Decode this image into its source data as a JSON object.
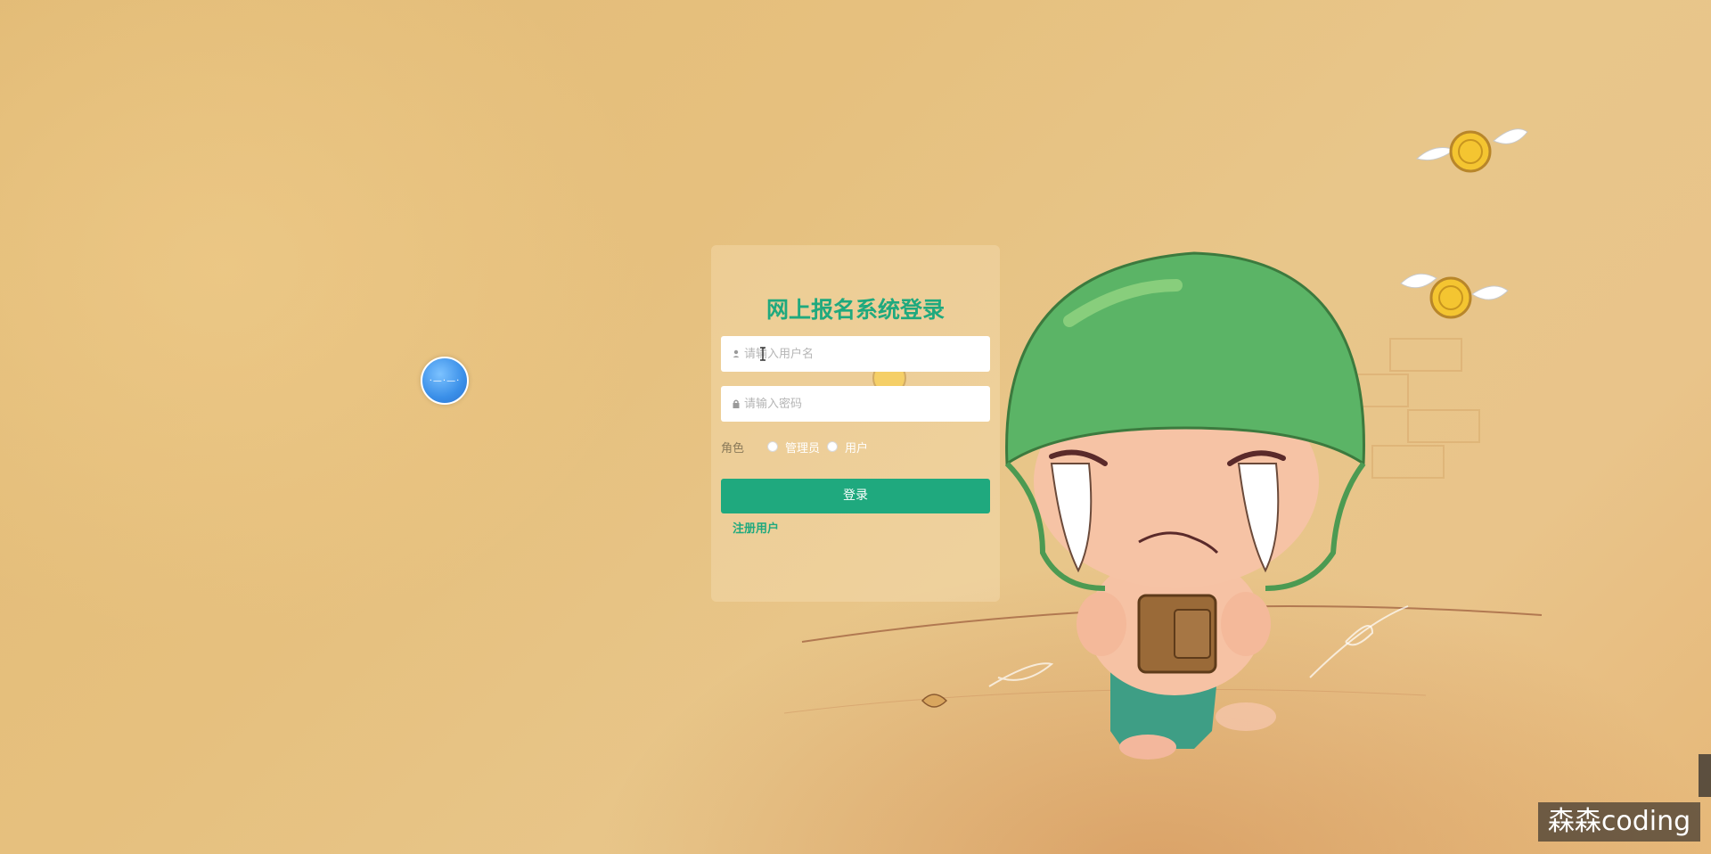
{
  "login": {
    "title": "网上报名系统登录",
    "username_placeholder": "请输入用户名",
    "password_placeholder": "请输入密码",
    "role_label": "角色",
    "roles": [
      "管理员",
      "用户"
    ],
    "login_button": "登录",
    "register_link": "注册用户"
  },
  "watermark": "森森coding",
  "icons": {
    "username": "user-icon",
    "password": "lock-icon",
    "float": "floating-ball-icon"
  },
  "colors": {
    "accent": "#1fa97e",
    "background": "#e6c07e",
    "helmet": "#5bb466"
  }
}
